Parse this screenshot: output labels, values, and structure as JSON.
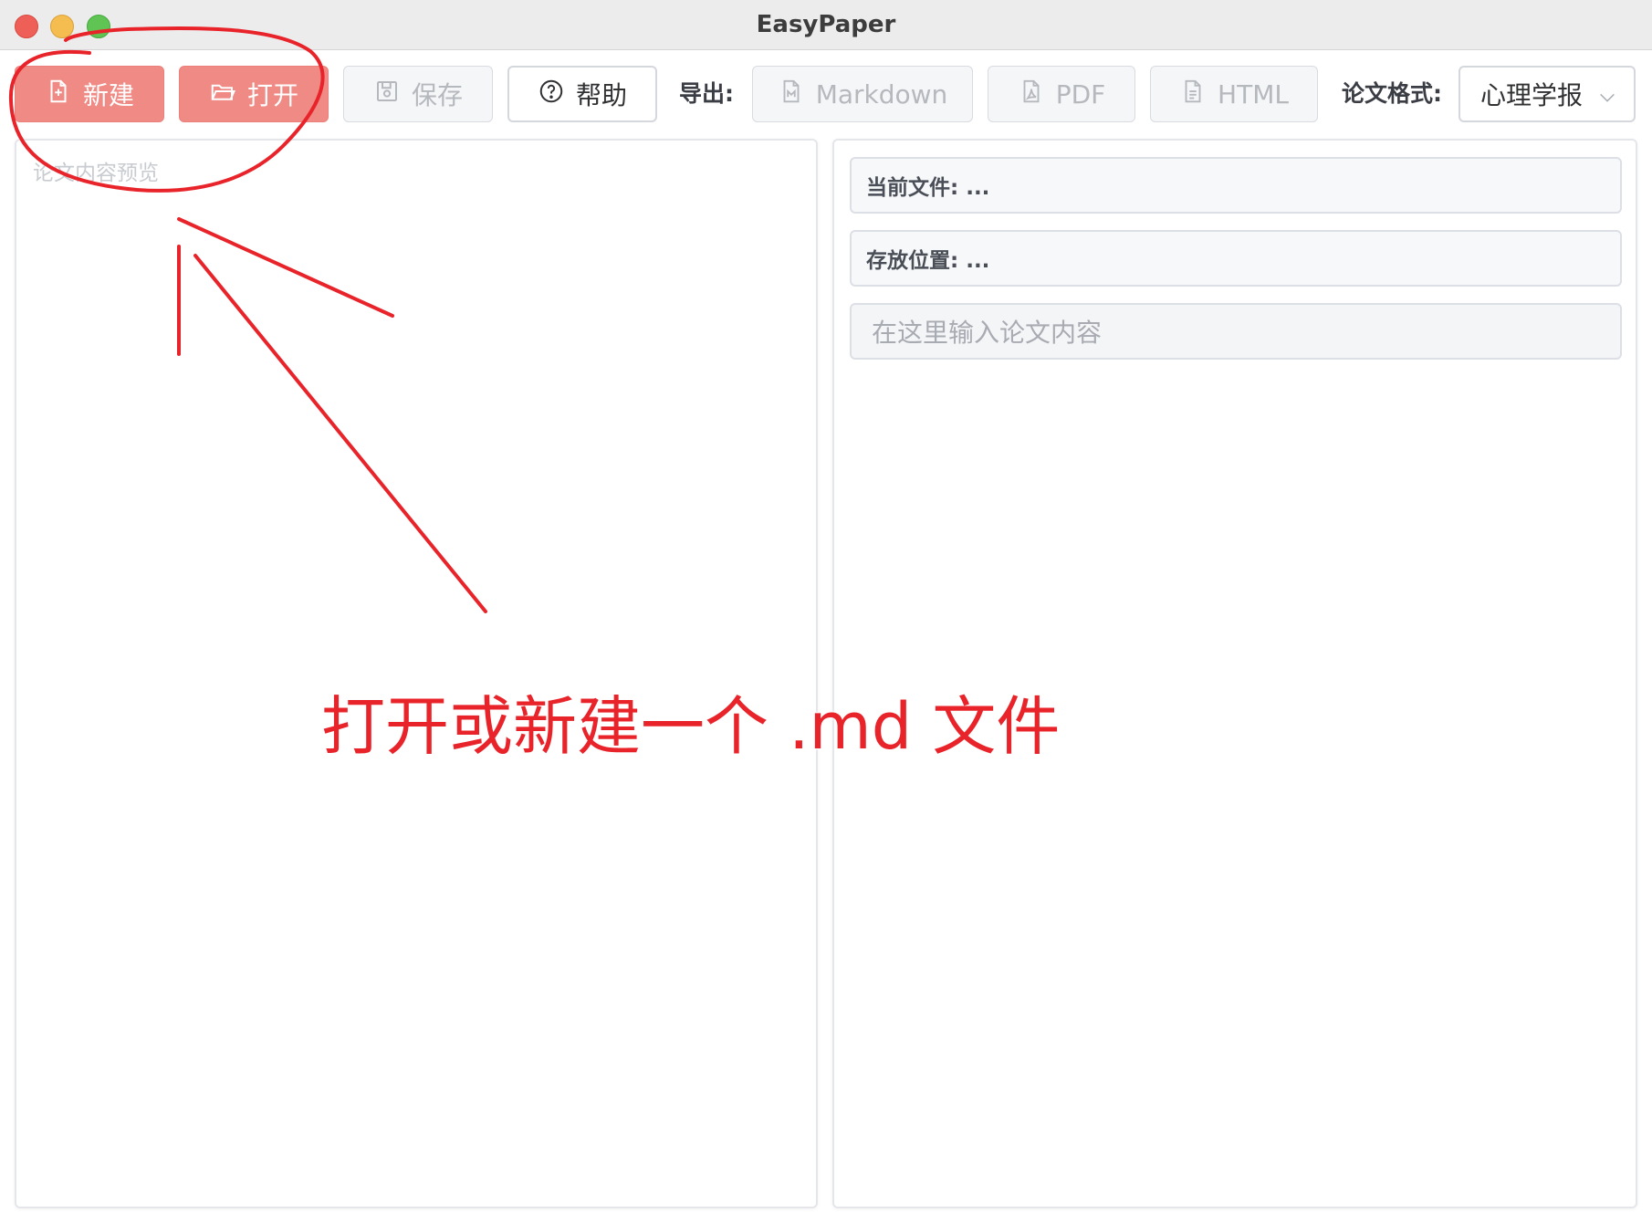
{
  "window": {
    "title": "EasyPaper"
  },
  "toolbar": {
    "new_label": "新建",
    "open_label": "打开",
    "save_label": "保存",
    "help_label": "帮助",
    "export_label": "导出:",
    "export_markdown": "Markdown",
    "export_pdf": "PDF",
    "export_html": "HTML",
    "format_label": "论文格式:",
    "format_selected": "心理学报"
  },
  "left_panel": {
    "placeholder": "论文内容预览"
  },
  "right_panel": {
    "current_file": "当前文件: ...",
    "location": "存放位置: ...",
    "content_placeholder": "在这里输入论文内容"
  },
  "annotation": {
    "text": "打开或新建一个 .md 文件",
    "color": "#e8242a"
  },
  "colors": {
    "primary": "#ef8a85",
    "disabled_text": "#b5b8bd"
  }
}
